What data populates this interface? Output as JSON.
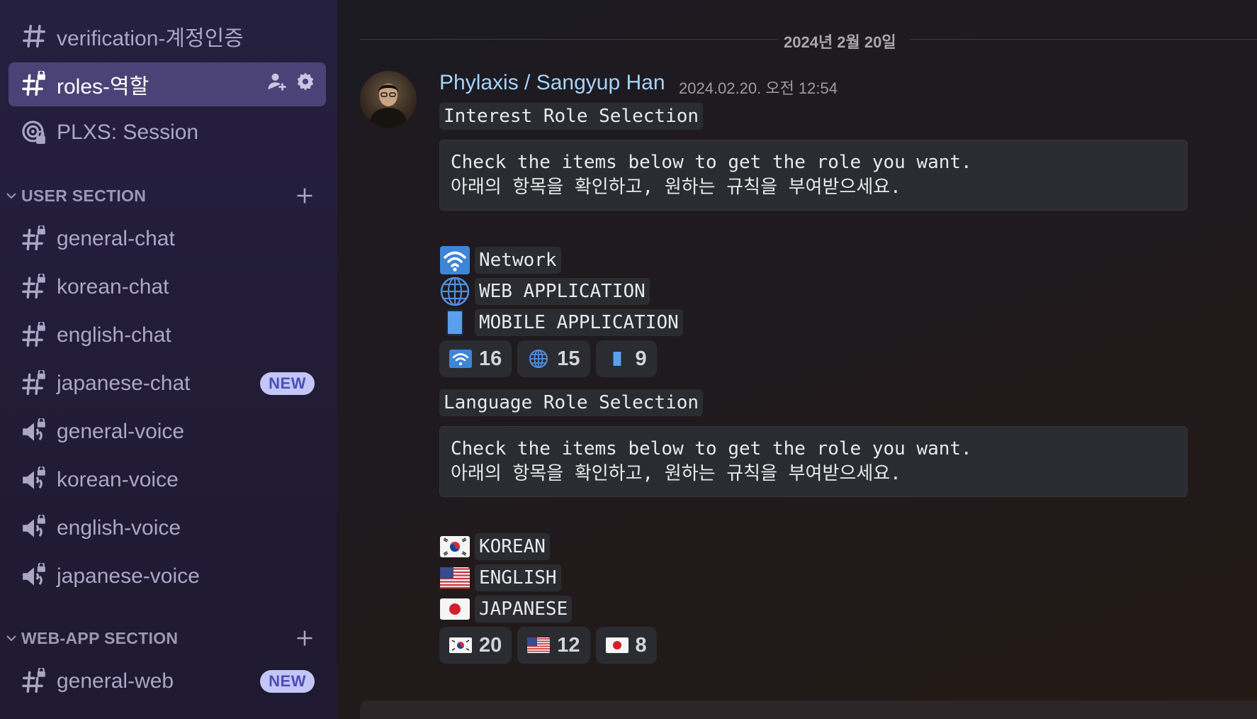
{
  "sidebar": {
    "channels_top": [
      {
        "label": "verification-계정인증",
        "icon": "hash-icon"
      },
      {
        "label": "roles-역할",
        "icon": "hash-lock-icon",
        "active": true
      },
      {
        "label": "PLXS: Session",
        "icon": "stage-icon"
      }
    ],
    "user_section": {
      "title": "USER SECTION",
      "channels": [
        {
          "label": "general-chat",
          "icon": "hash-lock-icon"
        },
        {
          "label": "korean-chat",
          "icon": "hash-lock-icon"
        },
        {
          "label": "english-chat",
          "icon": "hash-lock-icon"
        },
        {
          "label": "japanese-chat",
          "icon": "hash-lock-icon",
          "badge": "NEW"
        },
        {
          "label": "general-voice",
          "icon": "speaker-lock-icon"
        },
        {
          "label": "korean-voice",
          "icon": "speaker-lock-icon"
        },
        {
          "label": "english-voice",
          "icon": "speaker-lock-icon"
        },
        {
          "label": "japanese-voice",
          "icon": "speaker-lock-icon"
        }
      ]
    },
    "webapp_section": {
      "title": "WEB-APP SECTION",
      "channels": [
        {
          "label": "general-web",
          "icon": "hash-lock-icon",
          "badge": "NEW"
        }
      ]
    }
  },
  "main": {
    "date_divider": "2024년 2월 20일",
    "message": {
      "author": "Phylaxis / Sangyup Han",
      "timestamp": "2024.02.20. 오전 12:54",
      "interest": {
        "heading": "Interest Role Selection",
        "body_line1": "Check the items below to get the role you want.",
        "body_line2": "아래의 항목을 확인하고, 원하는 규칙을 부여받으세요.",
        "options": [
          {
            "emoji": "wifi-icon",
            "label": "Network"
          },
          {
            "emoji": "globe-icon",
            "label": "WEB APPLICATION"
          },
          {
            "emoji": "mobile-phone-icon",
            "label": "MOBILE APPLICATION"
          }
        ],
        "reactions": [
          {
            "emoji": "wifi-icon",
            "count": "16"
          },
          {
            "emoji": "globe-icon",
            "count": "15"
          },
          {
            "emoji": "mobile-phone-icon",
            "count": "9"
          }
        ]
      },
      "language": {
        "heading": "Language Role Selection",
        "body_line1": "Check the items below to get the role you want.",
        "body_line2": "아래의 항목을 확인하고, 원하는 규칙을 부여받으세요.",
        "options": [
          {
            "emoji": "korea-flag-icon",
            "label": "KOREAN"
          },
          {
            "emoji": "us-flag-icon",
            "label": "ENGLISH"
          },
          {
            "emoji": "japan-flag-icon",
            "label": "JAPANESE"
          }
        ],
        "reactions": [
          {
            "emoji": "korea-flag-icon",
            "count": "20"
          },
          {
            "emoji": "us-flag-icon",
            "count": "12"
          },
          {
            "emoji": "japan-flag-icon",
            "count": "8"
          }
        ]
      }
    }
  }
}
